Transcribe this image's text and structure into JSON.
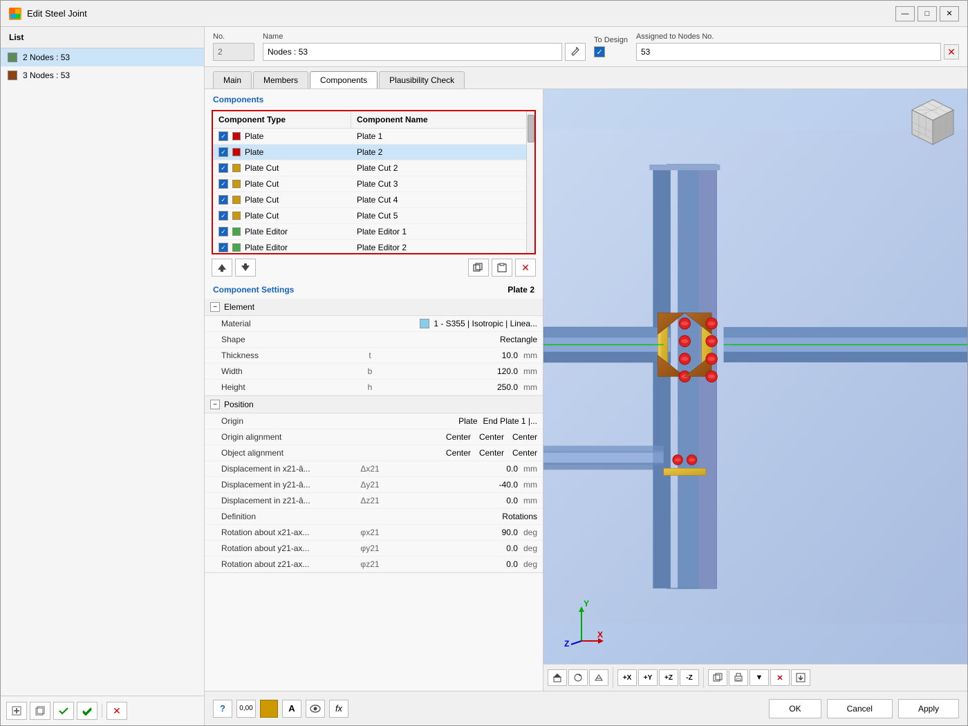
{
  "window": {
    "title": "Edit Steel Joint",
    "icon": "joint-icon"
  },
  "list": {
    "header": "List",
    "items": [
      {
        "id": 1,
        "label": "2 Nodes : 53",
        "color": "#5b8c5a",
        "selected": true
      },
      {
        "id": 2,
        "label": "3 Nodes : 53",
        "color": "#8b4513",
        "selected": false
      }
    ]
  },
  "no_field": {
    "label": "No.",
    "value": "2"
  },
  "name_field": {
    "label": "Name",
    "value": "Nodes : 53"
  },
  "to_design": {
    "label": "To Design",
    "checked": true
  },
  "assigned": {
    "label": "Assigned to Nodes No.",
    "value": "53"
  },
  "tabs": [
    {
      "id": "main",
      "label": "Main",
      "active": false
    },
    {
      "id": "members",
      "label": "Members",
      "active": false
    },
    {
      "id": "components",
      "label": "Components",
      "active": true
    },
    {
      "id": "plausibility",
      "label": "Plausibility Check",
      "active": false
    }
  ],
  "components_section": {
    "title": "Components",
    "column_type": "Component Type",
    "column_name": "Component Name",
    "items": [
      {
        "checked": true,
        "color": "#cc0000",
        "type": "Plate",
        "name": "Plate 1"
      },
      {
        "checked": true,
        "color": "#cc0000",
        "type": "Plate",
        "name": "Plate 2",
        "selected": true
      },
      {
        "checked": true,
        "color": "#cc9900",
        "type": "Plate Cut",
        "name": "Plate Cut 2"
      },
      {
        "checked": true,
        "color": "#cc9900",
        "type": "Plate Cut",
        "name": "Plate Cut 3"
      },
      {
        "checked": true,
        "color": "#cc9900",
        "type": "Plate Cut",
        "name": "Plate Cut 4"
      },
      {
        "checked": true,
        "color": "#cc9900",
        "type": "Plate Cut",
        "name": "Plate Cut 5"
      },
      {
        "checked": true,
        "color": "#44aa44",
        "type": "Plate Editor",
        "name": "Plate Editor 1"
      },
      {
        "checked": true,
        "color": "#44aa44",
        "type": "Plate Editor",
        "name": "Plate Editor 2"
      }
    ],
    "actions": {
      "add": "⬅",
      "remove": "➡",
      "copy": "📋",
      "paste": "📄",
      "delete": "✕"
    }
  },
  "component_settings": {
    "title": "Component Settings",
    "active_component": "Plate 2",
    "groups": [
      {
        "name": "Element",
        "expanded": true,
        "rows": [
          {
            "label": "Material",
            "unit": "",
            "value": "1 - S355 | Isotropic | Linea...",
            "type": "material"
          },
          {
            "label": "Shape",
            "unit": "",
            "value": "Rectangle",
            "type": "text"
          },
          {
            "label": "Thickness",
            "unit": "t",
            "value": "10.0",
            "value_unit": "mm",
            "type": "number"
          },
          {
            "label": "Width",
            "unit": "b",
            "value": "120.0",
            "value_unit": "mm",
            "type": "number"
          },
          {
            "label": "Height",
            "unit": "h",
            "value": "250.0",
            "value_unit": "mm",
            "type": "number"
          }
        ]
      },
      {
        "name": "Position",
        "expanded": true,
        "rows": [
          {
            "label": "Origin",
            "unit": "",
            "values": [
              "Plate",
              "End Plate 1 |..."
            ],
            "type": "multi"
          },
          {
            "label": "Origin alignment",
            "unit": "",
            "values": [
              "Center",
              "Center",
              "Center"
            ],
            "type": "triple"
          },
          {
            "label": "Object alignment",
            "unit": "",
            "values": [
              "Center",
              "Center",
              "Center"
            ],
            "type": "triple"
          },
          {
            "label": "Displacement in x21-â...",
            "unit": "Δx21",
            "value": "0.0",
            "value_unit": "mm",
            "type": "number"
          },
          {
            "label": "Displacement in y21-â...",
            "unit": "Δy21",
            "value": "-40.0",
            "value_unit": "mm",
            "type": "number"
          },
          {
            "label": "Displacement in z21-â...",
            "unit": "Δz21",
            "value": "0.0",
            "value_unit": "mm",
            "type": "number"
          },
          {
            "label": "Definition",
            "unit": "",
            "value": "Rotations",
            "type": "text"
          },
          {
            "label": "Rotation about x21-ax...",
            "unit": "φx21",
            "value": "90.0",
            "value_unit": "deg",
            "type": "number"
          },
          {
            "label": "Rotation about y21-ax...",
            "unit": "φy21",
            "value": "0.0",
            "value_unit": "deg",
            "type": "number"
          },
          {
            "label": "Rotation about z21-ax...",
            "unit": "φz21",
            "value": "0.0",
            "value_unit": "deg",
            "type": "number"
          }
        ]
      }
    ]
  },
  "bottom_buttons": {
    "ok": "OK",
    "cancel": "Cancel",
    "apply": "Apply"
  },
  "bottom_icons": [
    {
      "name": "help-icon",
      "symbol": "?"
    },
    {
      "name": "zero-icon",
      "symbol": "0,00"
    },
    {
      "name": "color-icon",
      "symbol": "■"
    },
    {
      "name": "text-icon",
      "symbol": "A"
    },
    {
      "name": "view-icon",
      "symbol": "👁"
    },
    {
      "name": "formula-icon",
      "symbol": "fx"
    }
  ]
}
